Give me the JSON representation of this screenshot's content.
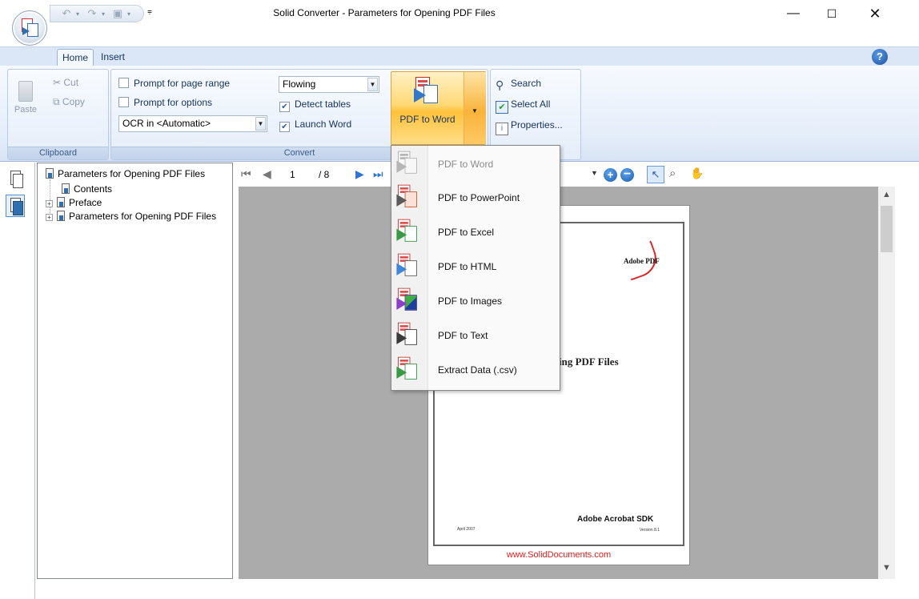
{
  "window": {
    "title": "Solid Converter - Parameters for Opening PDF Files",
    "minimize_glyph": "—",
    "maximize_glyph": "☐",
    "close_glyph": "✕",
    "qat_customize_glyph": "⩦"
  },
  "ribbon": {
    "tabs": [
      {
        "label": "Home",
        "active": true
      },
      {
        "label": "Insert",
        "active": false
      }
    ],
    "help_glyph": "?",
    "clipboard": {
      "group_label": "Clipboard",
      "paste_label": "Paste",
      "cut_label": "Cut",
      "copy_label": "Copy"
    },
    "convert": {
      "group_label": "Convert",
      "prompt_page_range_label": "Prompt for page range",
      "prompt_page_range_checked": false,
      "prompt_options_label": "Prompt for options",
      "prompt_options_checked": false,
      "ocr_value": "OCR in <Automatic>",
      "layout_value": "Flowing",
      "detect_tables_label": "Detect tables",
      "detect_tables_checked": true,
      "launch_word_label": "Launch Word",
      "launch_word_checked": true,
      "convert_button_label": "PDF to Word"
    },
    "search_group": {
      "search_label": "Search",
      "select_all_label": "Select All",
      "properties_label": "Properties..."
    }
  },
  "bookmarks": {
    "root": "Parameters for Opening PDF Files",
    "items": [
      {
        "label": "Contents",
        "expandable": false
      },
      {
        "label": "Preface",
        "expandable": true
      },
      {
        "label": "Parameters for Opening PDF Files",
        "expandable": true
      }
    ],
    "expander_glyph": "+"
  },
  "viewer": {
    "current_page": "1",
    "total_pages": "/ 8",
    "page": {
      "logo_text": "Adobe PDF",
      "title_fragment": "ening PDF Files",
      "sdk_text": "Adobe Acrobat SDK",
      "version_text": "Version 8.1",
      "date_text": "April 2007",
      "watermark": "www.SolidDocuments.com"
    }
  },
  "convert_menu": {
    "items": [
      {
        "label": "PDF to Word",
        "enabled": false
      },
      {
        "label": "PDF to PowerPoint",
        "enabled": true
      },
      {
        "label": "PDF to Excel",
        "enabled": true
      },
      {
        "label": "PDF to HTML",
        "enabled": true
      },
      {
        "label": "PDF to Images",
        "enabled": true
      },
      {
        "label": "PDF to Text",
        "enabled": true
      },
      {
        "label": "Extract Data (.csv)",
        "enabled": true
      }
    ]
  },
  "colors": {
    "accent_blue": "#2e74d2",
    "ribbon_highlight": "#ffd978",
    "watermark_red": "#e01b1b"
  }
}
